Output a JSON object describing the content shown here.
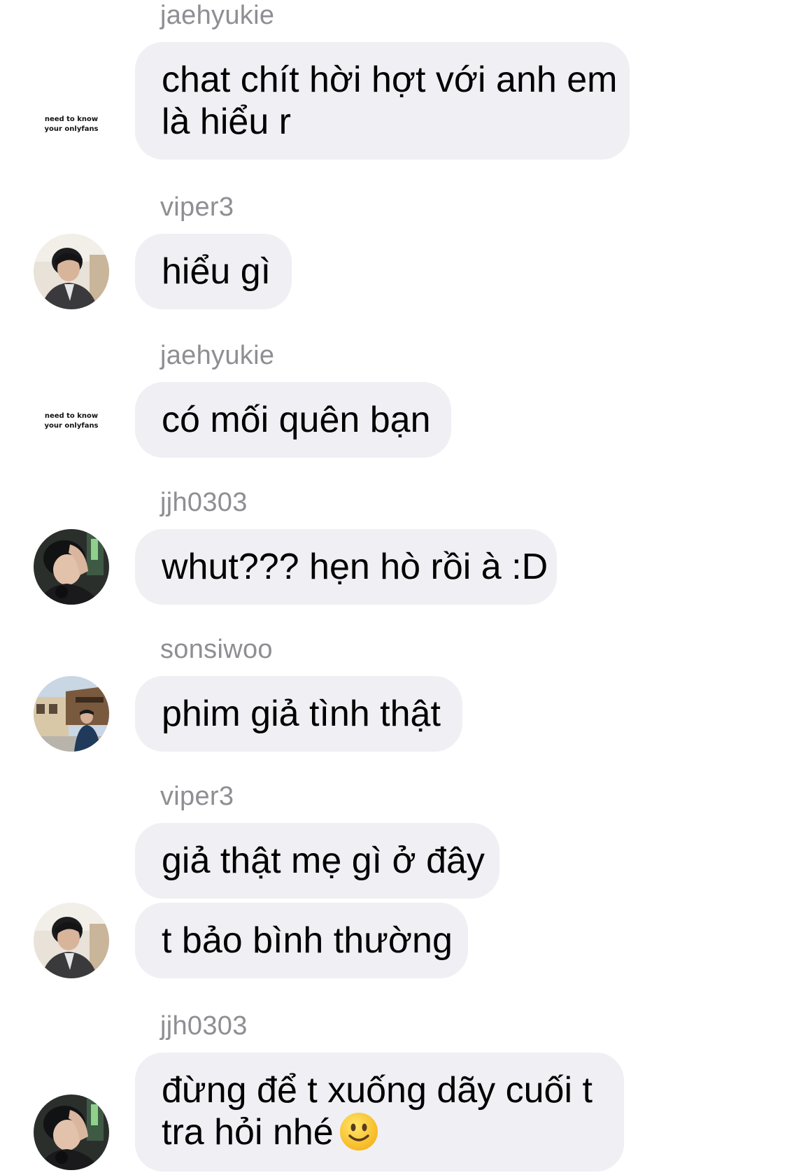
{
  "messages": [
    {
      "sender": "jaehyukie",
      "lines": [
        "chat chít hời hợt với anh em",
        "là hiểu r"
      ],
      "avatar_text": [
        "need to know",
        "your onlyfans"
      ]
    },
    {
      "sender": "viper3",
      "lines": [
        "hiểu gì"
      ]
    },
    {
      "sender": "jaehyukie",
      "lines": [
        "có mối quên bạn"
      ],
      "avatar_text": [
        "need to know",
        "your onlyfans"
      ]
    },
    {
      "sender": "jjh0303",
      "lines": [
        "whut??? hẹn hò rồi à :D"
      ]
    },
    {
      "sender": "sonsiwoo",
      "lines": [
        "phim giả tình thật"
      ]
    },
    {
      "sender": "viper3",
      "lines": [
        "giả thật mẹ gì ở đây",
        "t bảo bình thường"
      ]
    },
    {
      "sender": "jjh0303",
      "lines": [
        "đừng để t xuống dãy cuối t",
        "tra hỏi nhé"
      ],
      "emoji": "slightly-smiling-face-icon"
    }
  ],
  "colors": {
    "bubble_bg": "#efeff4",
    "sender_text": "#8e8e93",
    "message_text": "#000000",
    "background": "#ffffff"
  }
}
